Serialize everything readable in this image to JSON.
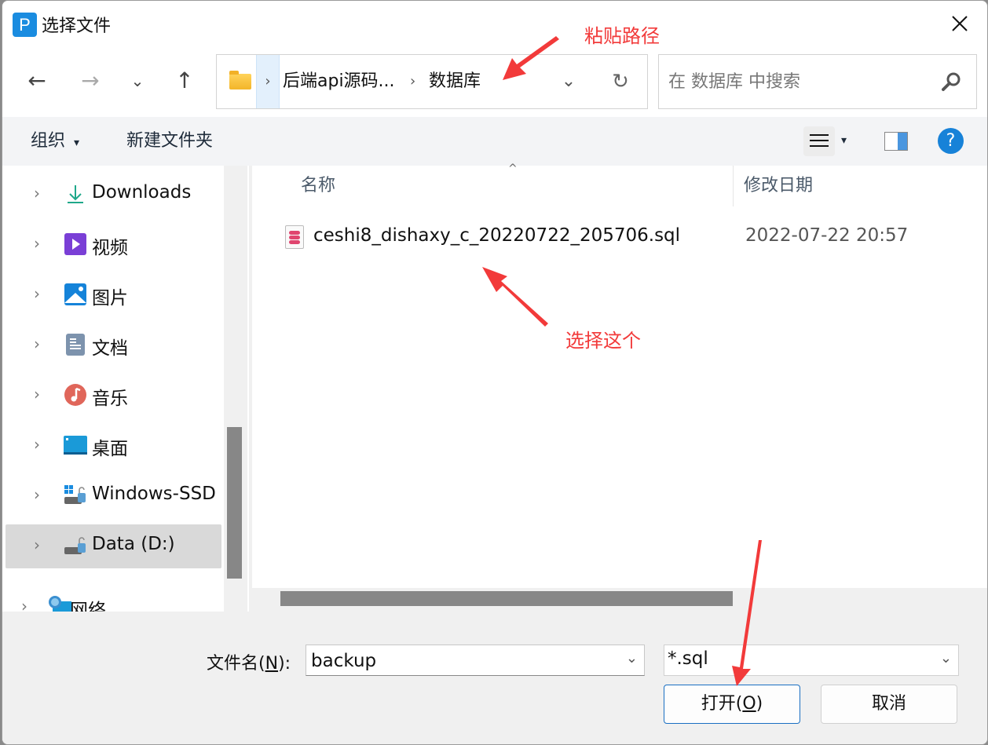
{
  "dialog": {
    "title": "选择文件",
    "app_icon_letter": "P"
  },
  "nav": {
    "back_icon": "←",
    "forward_icon": "→",
    "recent_icon": "⌄",
    "up_icon": "↑"
  },
  "address_bar": {
    "segments": [
      "后端api源码...",
      "数据库"
    ],
    "separator": "›",
    "dropdown_icon": "⌄",
    "refresh_icon": "↻"
  },
  "search": {
    "placeholder": "在 数据库 中搜索",
    "value": ""
  },
  "command_bar": {
    "organize_label": "组织",
    "organize_caret": "▾",
    "new_folder_label": "新建文件夹",
    "view_caret": "▾",
    "help_label": "?"
  },
  "sidebar": {
    "chevron": "›",
    "items": [
      {
        "label": "Downloads",
        "icon": "download-icon",
        "selected": false
      },
      {
        "label": "视频",
        "icon": "videos-icon",
        "selected": false
      },
      {
        "label": "图片",
        "icon": "pictures-icon",
        "selected": false
      },
      {
        "label": "文档",
        "icon": "documents-icon",
        "selected": false
      },
      {
        "label": "音乐",
        "icon": "music-icon",
        "selected": false
      },
      {
        "label": "桌面",
        "icon": "desktop-icon",
        "selected": false
      },
      {
        "label": "Windows-SSD",
        "icon": "windows-drive-icon",
        "selected": false
      },
      {
        "label": "Data (D:)",
        "icon": "data-drive-icon",
        "selected": true
      },
      {
        "label": "网络",
        "icon": "network-icon",
        "selected": false
      }
    ]
  },
  "file_list": {
    "sort_caret": "^",
    "columns": [
      "名称",
      "修改日期"
    ],
    "rows": [
      {
        "name": "ceshi8_dishaxy_c_20220722_205706.sql",
        "modified": "2022-07-22 20:57",
        "icon": "sql-file-icon"
      }
    ]
  },
  "footer": {
    "filename_label_prefix": "文件名(",
    "filename_label_key": "N",
    "filename_label_suffix": "):",
    "filename_value": "backup",
    "filetype_value": "*.sql",
    "dropdown_icon": "⌄",
    "open_prefix": "打开(",
    "open_key": "O",
    "open_suffix": ")",
    "cancel_label": "取消"
  },
  "annotations": {
    "paste_path": "粘贴路径",
    "select_this": "选择这个",
    "color": "#f23a3a"
  }
}
